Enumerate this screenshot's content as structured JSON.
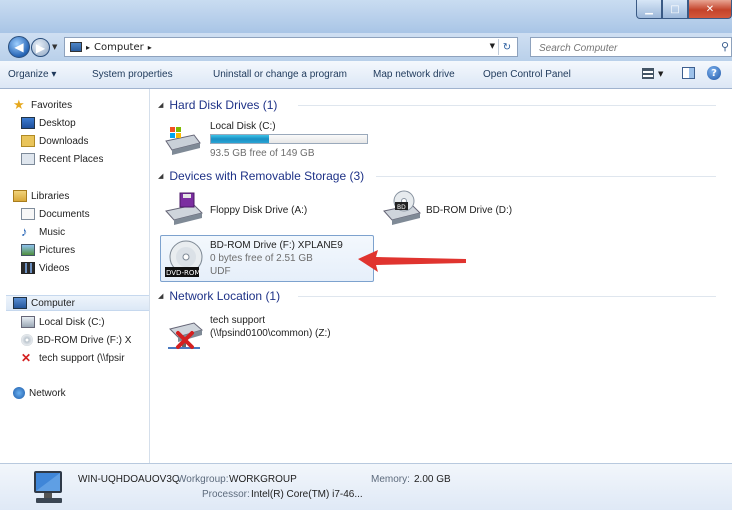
{
  "address": {
    "path": "Computer",
    "search_placeholder": "Search Computer"
  },
  "toolbar": {
    "organize": "Organize ▾",
    "system_properties": "System properties",
    "uninstall": "Uninstall or change a program",
    "map_drive": "Map network drive",
    "control_panel": "Open Control Panel"
  },
  "sidebar": {
    "favorites": "Favorites",
    "desktop": "Desktop",
    "downloads": "Downloads",
    "recent": "Recent Places",
    "libraries": "Libraries",
    "documents": "Documents",
    "music": "Music",
    "pictures": "Pictures",
    "videos": "Videos",
    "computer": "Computer",
    "local_disk": "Local Disk (C:)",
    "bdrom_f": "BD-ROM Drive (F:) X",
    "tech_support": "tech support (\\\\fpsir",
    "network": "Network"
  },
  "groups": {
    "hdd": "Hard Disk Drives (1)",
    "removable": "Devices with Removable Storage (3)",
    "network": "Network Location (1)"
  },
  "drives": {
    "c_name": "Local Disk (C:)",
    "c_free": "93.5 GB free of 149 GB",
    "c_used_fraction": 0.37,
    "floppy": "Floppy Disk Drive (A:)",
    "bdrom_d": "BD-ROM Drive (D:)",
    "bdrom_f_name": "BD-ROM Drive (F:) XPLANE9",
    "bdrom_f_free": "0 bytes free of 2.51 GB",
    "bdrom_f_fs": "UDF",
    "net_name": "tech support",
    "net_path": "(\\\\fpsind0100\\common) (Z:)"
  },
  "details": {
    "computer_name": "WIN-UQHDOAUOV3Q",
    "workgroup_label": "Workgroup:",
    "workgroup": "WORKGROUP",
    "memory_label": "Memory:",
    "memory": "2.00 GB",
    "processor_label": "Processor:",
    "processor": "Intel(R) Core(TM) i7-46..."
  },
  "icons": {
    "dvd_label": "DVD-ROM",
    "bd_label": "BD"
  },
  "colors": {
    "annotation_arrow": "#e0342f",
    "group_header": "#1e3287"
  }
}
